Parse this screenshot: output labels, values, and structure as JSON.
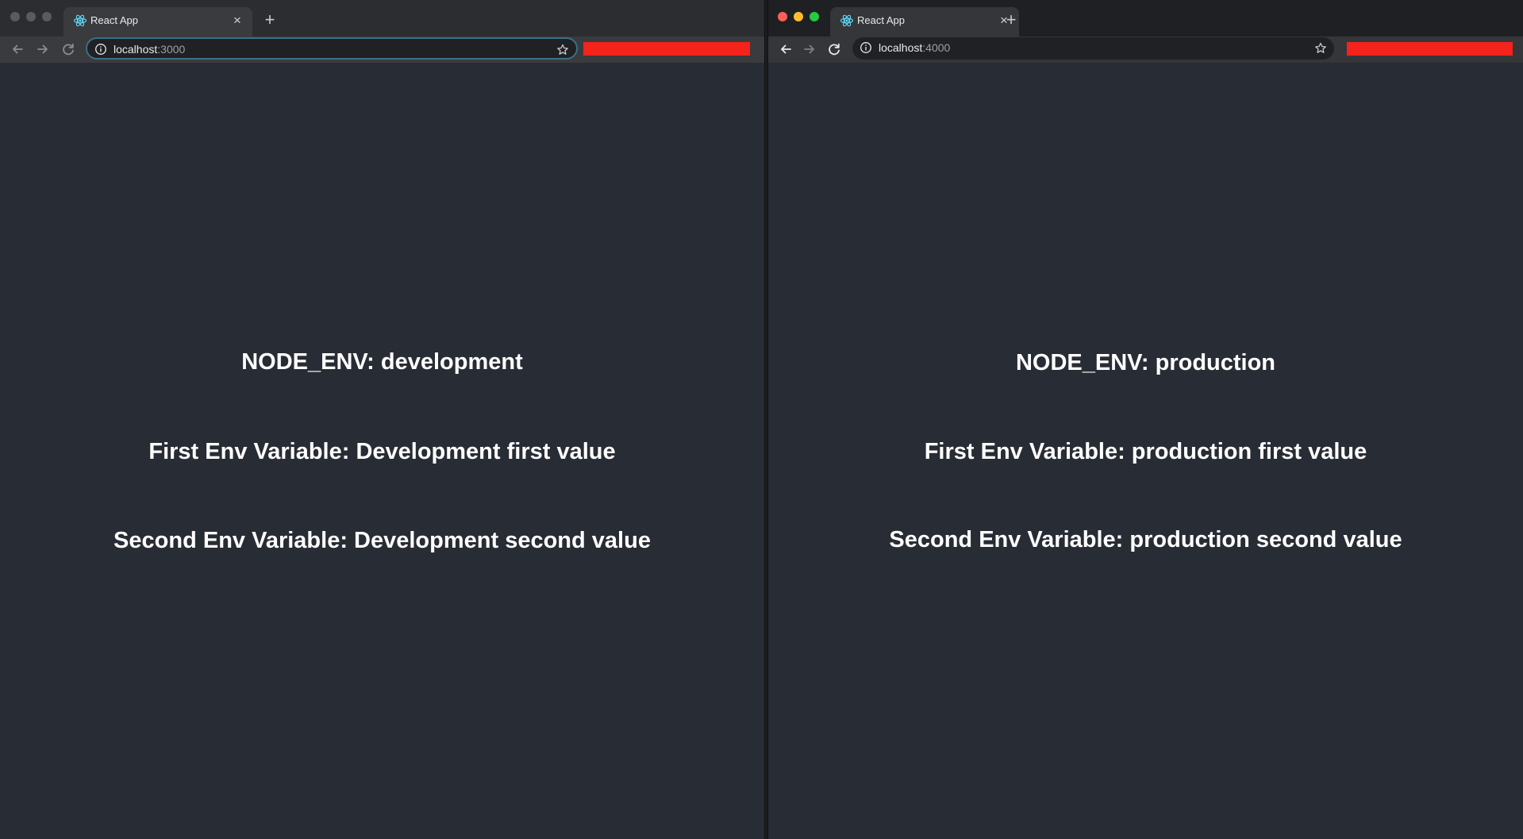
{
  "colors": {
    "page_background": "#282c34",
    "redaction": "#f5231b",
    "omnibox_focus": "#3c6f86"
  },
  "windows": [
    {
      "id": "left",
      "traffic_lights": [
        "#5a5b5e",
        "#5a5b5e",
        "#5a5b5e"
      ],
      "tab": {
        "title": "React App",
        "favicon": "react-logo-icon",
        "close": "×"
      },
      "new_tab": "+",
      "address": {
        "host": "localhost",
        "port": ":3000"
      },
      "content": {
        "node_env": "NODE_ENV: development",
        "first": "First Env Variable: Development first value",
        "second": "Second Env Variable: Development second value"
      }
    },
    {
      "id": "right",
      "traffic_lights": [
        "#ff5f57",
        "#febc2e",
        "#28c840"
      ],
      "tab": {
        "title": "React App",
        "favicon": "react-logo-icon",
        "close": "×"
      },
      "new_tab": "+",
      "address": {
        "host": "localhost",
        "port": ":4000"
      },
      "content": {
        "node_env": "NODE_ENV: production",
        "first": "First Env Variable: production first value",
        "second": "Second Env Variable: production second value"
      }
    }
  ]
}
